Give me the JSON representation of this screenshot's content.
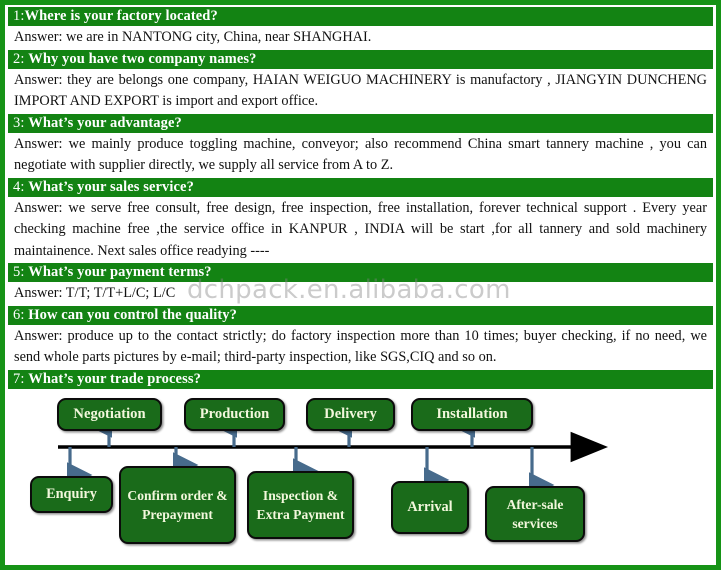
{
  "colors": {
    "border_green": "#169316",
    "header_green": "#138313",
    "box_green": "#1a6b1a",
    "box_text": "#f2f7dc",
    "connector_blue": "#476b8c",
    "axis_black": "#000000",
    "watermark": "rgba(130,130,130,0.42)"
  },
  "watermark": "dchpack.en.alibaba.com",
  "faq": [
    {
      "num": "1:",
      "question": "Where is your factory located?",
      "answer": "Answer: we are in NANTONG city, China, near SHANGHAI.",
      "justify": false
    },
    {
      "num": "2:",
      "question": "Why you have two company names?",
      "answer": "Answer: they are belongs one company, HAIAN WEIGUO MACHINERY is manufactory , JIANGYIN DUNCHENG IMPORT AND EXPORT is import and export office.",
      "justify": true
    },
    {
      "num": "3:",
      "question": "What’s your advantage?",
      "answer": "Answer: we mainly produce toggling machine, conveyor; also recommend China smart tannery machine , you can negotiate with supplier directly, we supply all service from A to Z.",
      "justify": true
    },
    {
      "num": "4:",
      "question": "What’s your sales service?",
      "answer": "Answer: we serve free consult, free design, free inspection, free installation, forever technical support . Every year checking machine free ,the service office in KANPUR , INDIA will be start ,for all tannery and sold machinery maintainence. Next sales office readying ----",
      "justify": true
    },
    {
      "num": "5:",
      "question": "What’s your payment terms?",
      "answer": "Answer: T/T;    T/T+L/C;    L/C",
      "justify": false
    },
    {
      "num": "6:",
      "question": "How can you control the quality?",
      "answer": "Answer: produce up to the contact strictly; do factory inspection more than 10 times; buyer checking, if no need, we send whole parts pictures by e-mail; third-party inspection, like SGS,CIQ and so on.",
      "justify": true
    },
    {
      "num": "7:",
      "question": "What’s your trade process?",
      "answer": "",
      "justify": false
    }
  ],
  "flowchart": {
    "type": "process-timeline",
    "above_steps": [
      {
        "label": "Negotiation"
      },
      {
        "label": "Production"
      },
      {
        "label": "Delivery"
      },
      {
        "label": "Installation"
      }
    ],
    "below_steps": [
      {
        "label": "Enquiry"
      },
      {
        "label": "Confirm order & Prepayment"
      },
      {
        "label": "Inspection & Extra Payment"
      },
      {
        "label": "Arrival"
      },
      {
        "label": "After-sale services"
      }
    ],
    "order": [
      "Enquiry",
      "Negotiation",
      "Confirm order & Prepayment",
      "Production",
      "Inspection & Extra Payment",
      "Delivery",
      "Arrival",
      "Installation",
      "After-sale services"
    ]
  }
}
